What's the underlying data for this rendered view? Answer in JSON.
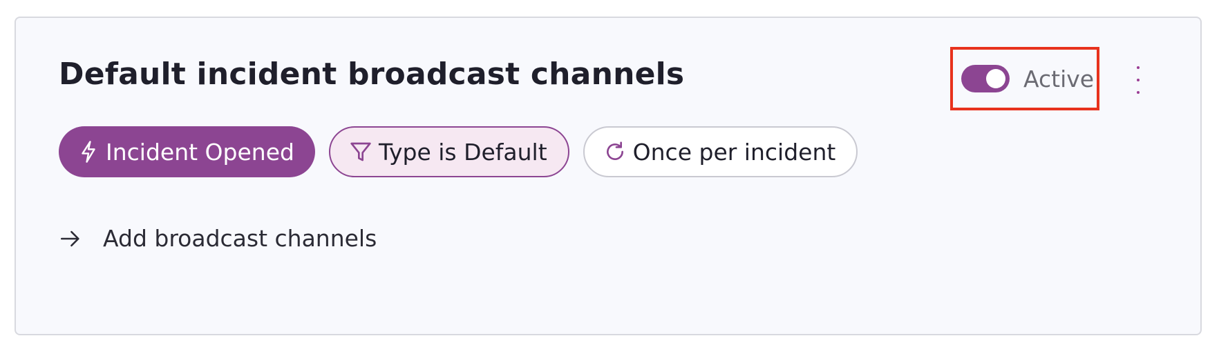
{
  "card": {
    "title": "Default incident broadcast channels",
    "status_toggle": {
      "label": "Active",
      "on": true
    },
    "more_menu_icon": "vertical-ellipsis-icon",
    "chips": [
      {
        "label": "Incident Opened",
        "icon": "lightning-bolt-icon"
      },
      {
        "label": "Type is Default",
        "icon": "filter-funnel-icon"
      },
      {
        "label": "Once per incident",
        "icon": "refresh-icon"
      }
    ],
    "add_action": {
      "label": "Add broadcast channels",
      "icon": "arrow-right-icon"
    }
  },
  "colors": {
    "accent": "#8c4592",
    "highlight_border": "#e8321d",
    "card_background": "#f8f9fd"
  }
}
